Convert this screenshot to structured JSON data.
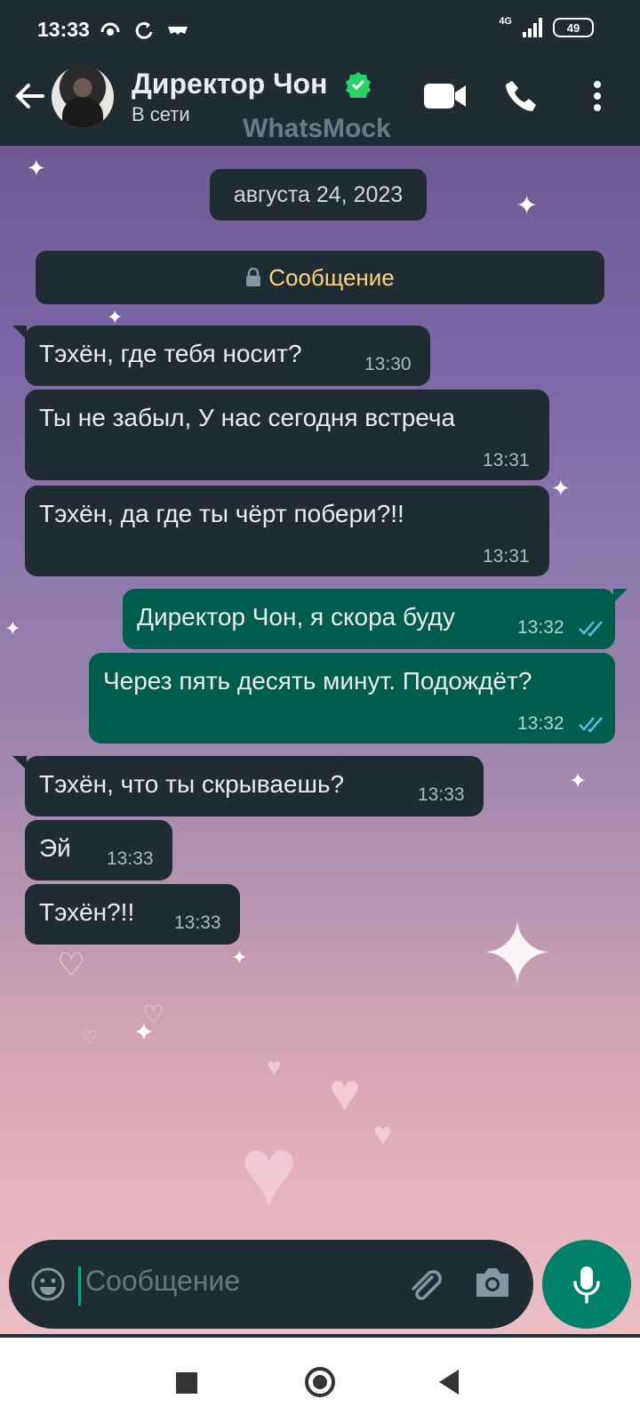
{
  "status_bar": {
    "time": "13:33",
    "network": "4G",
    "battery": "49"
  },
  "header": {
    "contact_name": "Директор Чон",
    "contact_status": "В сети",
    "watermark": "WhatsMock"
  },
  "chat": {
    "date": "августа 24, 2023",
    "encryption_banner": "Сообщение",
    "messages": [
      {
        "direction": "in",
        "text": "Тэхён, где тебя носит?",
        "time": "13:30"
      },
      {
        "direction": "in",
        "text": "Ты не забыл, У нас сегодня встреча",
        "time": "13:31"
      },
      {
        "direction": "in",
        "text": "Тэхён, да где ты чёрт побери?!!",
        "time": "13:31"
      },
      {
        "direction": "out",
        "text": "Директор Чон, я скора буду",
        "time": "13:32",
        "status": "read"
      },
      {
        "direction": "out",
        "text": "Через пять десять минут. Подождёт?",
        "time": "13:32",
        "status": "read"
      },
      {
        "direction": "in",
        "text": "Тэхён, что ты скрываешь?",
        "time": "13:33"
      },
      {
        "direction": "in",
        "text": "Эй",
        "time": "13:33"
      },
      {
        "direction": "in",
        "text": "Тэхён?!!",
        "time": "13:33"
      }
    ]
  },
  "composer": {
    "placeholder": "Сообщение"
  },
  "colors": {
    "header_bg": "#1f2c34",
    "incoming_bubble": "#202c33",
    "outgoing_bubble": "#005c4b",
    "accent": "#00a884",
    "read_ticks": "#53bdeb"
  }
}
